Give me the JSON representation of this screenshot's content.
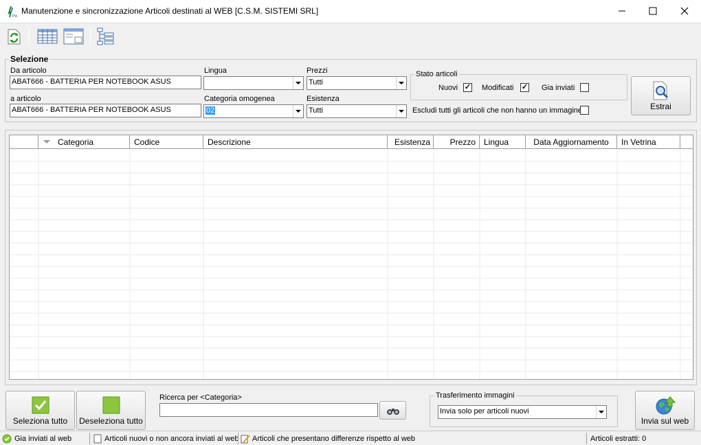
{
  "window": {
    "title": "Manutenzione e sincronizzazione Articoli destinati al WEB [C.S.M. SISTEMI SRL]"
  },
  "toolbar": {
    "icons": [
      "refresh-icon",
      "grid-icon",
      "form-view-icon",
      "tree-icon"
    ]
  },
  "selezione": {
    "legend": "Selezione",
    "da_articolo_label": "Da articolo",
    "da_articolo_value": "ABAT666 - BATTERIA PER NOTEBOOK ASUS",
    "a_articolo_label": "a articolo",
    "a_articolo_value": "ABAT666 - BATTERIA PER NOTEBOOK ASUS",
    "lingua_label": "Lingua",
    "lingua_value": "",
    "categoria_label": "Categoria omogenea",
    "categoria_value": "02",
    "prezzi_label": "Prezzi",
    "prezzi_value": "Tutti",
    "esistenza_label": "Esistenza",
    "esistenza_value": "Tutti"
  },
  "stato": {
    "legend": "Stato articoli",
    "nuovi_label": "Nuovi",
    "nuovi_checked": true,
    "modificati_label": "Modificati",
    "modificati_checked": true,
    "gia_inviati_label": "Gia inviati",
    "gia_inviati_checked": false,
    "escludi_label": "Escludi tutti gli articoli che non hanno un immagine",
    "escludi_checked": false
  },
  "estrai_label": "Estrai",
  "grid": {
    "columns": [
      "Categoria",
      "Codice",
      "Descrizione",
      "Esistenza",
      "Prezzo",
      "Lingua",
      "Data Aggiornamento",
      "In Vetrina"
    ]
  },
  "bottom": {
    "seleziona_label": "Seleziona tutto",
    "deseleziona_label": "Deseleziona tutto",
    "ricerca_label": "Ricerca per <Categoria>",
    "ricerca_value": "",
    "trasferimento_legend": "Trasferimento immagini",
    "trasferimento_value": "Invia solo per articoli nuovi",
    "invia_label": "Invia sul web"
  },
  "status": {
    "gia_inviati": "Gia inviati al web",
    "nuovi": "Articoli nuovi o non ancora inviati al web",
    "differenze": "Articoli che presentano differenze rispetto al web",
    "estratti": "Articoli estratti: 0"
  }
}
